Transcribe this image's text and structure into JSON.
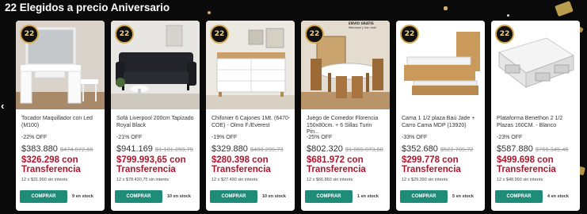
{
  "section_title": "22 Elegidos a precio Aniversario",
  "badge_text": "22",
  "buy_label": "COMPRAR",
  "buy_icon": "cart-icon",
  "prev_arrow_icon": "chevron-left-icon",
  "colors": {
    "accent": "#1f8c79",
    "transfer_price": "#b0162d",
    "background": "#0a0a0a"
  },
  "promo": {
    "title": "ENVIO GRATIS",
    "subtitle": "Mendoza y San Juan"
  },
  "products": [
    {
      "name": "Tocador Maquillador con Led (M100)",
      "discount": "-22% OFF",
      "price": "$383.880",
      "old_price": "$474.072,66",
      "transfer": "$326.298 con Transferencia",
      "installments": "12 x $31.990 sin interés",
      "stock": "9 en stock"
    },
    {
      "name": "Sofá Liverpool 200cm Tapizado Royal Black",
      "discount": "-21% OFF",
      "price": "$941.169",
      "old_price": "$1.181.259,79",
      "transfer": "$799.993,65 con Transferencia",
      "installments": "12 x $78.430,75 sin interés",
      "stock": "10 en stock"
    },
    {
      "name": "Chifonier 6 Cajones 1Mt. (6470-COE) - Olmo F./Everest",
      "discount": "-19% OFF",
      "price": "$329.880",
      "old_price": "$408.299,73",
      "transfer": "$280.398 con Transferencia",
      "installments": "12 x $27.490 sin interés",
      "stock": "10 en stock"
    },
    {
      "name": "Juego de Comedor Florencia 150x80cm. + 6 Sillas Turin Pin...",
      "discount": "-25% OFF",
      "price": "$802.320",
      "old_price": "$1.069.073,68",
      "transfer": "$681.972 con Transferencia",
      "installments": "12 x $66.860 sin interés",
      "stock": "1 en stock"
    },
    {
      "name": "Cama 1 1/2 plaza Baú Jade + Carro Cama MDP (13920)",
      "discount": "-33% OFF",
      "price": "$352.680",
      "old_price": "$522.709,72",
      "transfer": "$299.778 con Transferencia",
      "installments": "12 x $29.390 sin interés",
      "stock": "5 en stock"
    },
    {
      "name": "Plataforma Benethon 2 1/2 Plazas 160CM. - Blanco",
      "discount": "-23% OFF",
      "price": "$587.880",
      "old_price": "$766.345,46",
      "transfer": "$499.698 con Transferencia",
      "installments": "12 x $48.990 sin interés",
      "stock": "4 en stock"
    }
  ]
}
